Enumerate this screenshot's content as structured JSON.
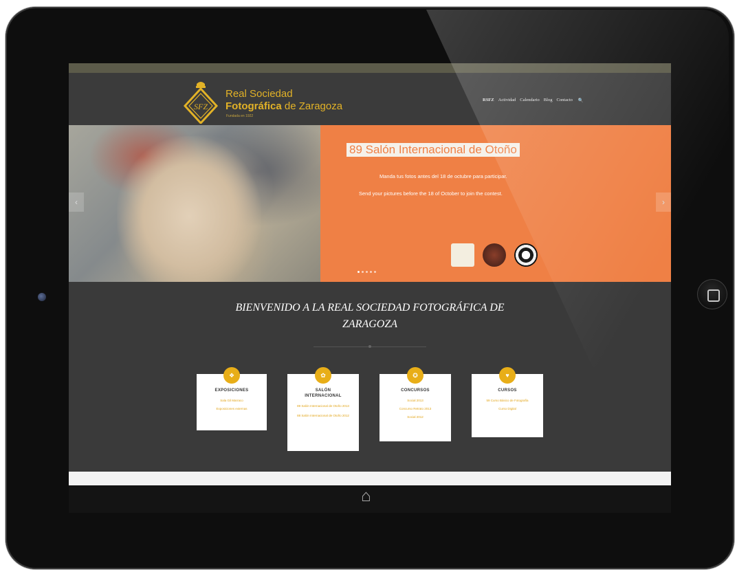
{
  "header": {
    "brand_line1": "Real Sociedad",
    "brand_line2_bold": "Fotográfica",
    "brand_line2_rest": " de Zaragoza",
    "brand_sub": "Fundada en 1922",
    "logo_text": "SFZ",
    "nav": [
      "RSFZ",
      "Actividad",
      "Calendario",
      "Blog",
      "Contacto"
    ],
    "search_icon": "🔍"
  },
  "slider": {
    "title": "89 Salón Internacional de Otoño",
    "line1": "Manda tus fotos antes del 18 de octubre para participar.",
    "line2": "Send your pictures before the 18 of October to join the contest.",
    "prev": "‹",
    "next": "›",
    "dots": 5,
    "active_dot": 0
  },
  "welcome": {
    "line1": "BIENVENIDO A LA REAL SOCIEDAD FOTOGRÁFICA DE",
    "line2": "ZARAGOZA"
  },
  "cards": [
    {
      "title": "EXPOSICIONES",
      "icon": "❖",
      "links": [
        "Sala Gil Marraco",
        "Exposiciones externas"
      ]
    },
    {
      "title": "SALÓN INTERNACIONAL",
      "icon": "✿",
      "links": [
        "89 Salón Internacional de Otoño 2013",
        "88 Salón Internacional de Otoño 2012"
      ]
    },
    {
      "title": "CONCURSOS",
      "icon": "✪",
      "links": [
        "Social 2013",
        "Concurso Retrato 2013",
        "Social 2012"
      ]
    },
    {
      "title": "CURSOS",
      "icon": "♥",
      "links": [
        "59 Curso Básico de Fotografía",
        "Curso Digital"
      ]
    }
  ],
  "device": {
    "home_icon": "⌂"
  },
  "colors": {
    "accent": "#e2b227",
    "slide_bg": "#ef8045",
    "page_bg": "#3a3a3a"
  }
}
